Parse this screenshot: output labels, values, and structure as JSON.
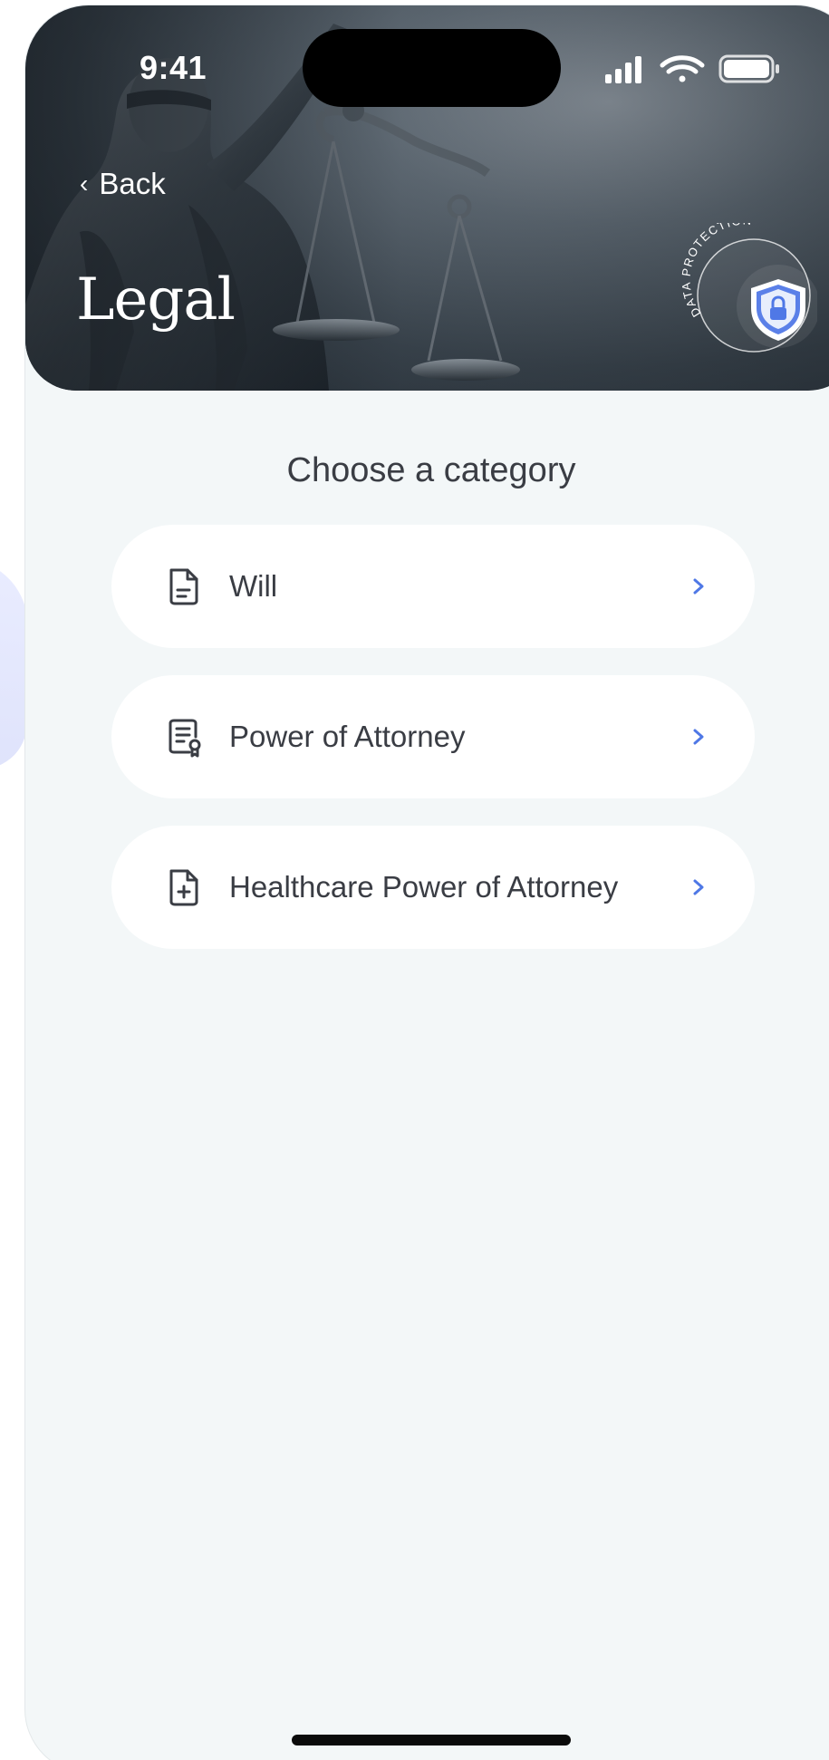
{
  "status_bar": {
    "time": "9:41",
    "icons": [
      "signal-icon",
      "wifi-icon",
      "battery-icon"
    ]
  },
  "header": {
    "back_label": "Back",
    "title": "Legal",
    "badge_text": "DATA PROTECTION",
    "badge_icon": "shield-lock-icon"
  },
  "main": {
    "heading": "Choose a category",
    "categories": [
      {
        "label": "Will",
        "icon": "document-icon"
      },
      {
        "label": "Power of Attorney",
        "icon": "certificate-icon"
      },
      {
        "label": "Healthcare Power of Attorney",
        "icon": "medical-document-icon"
      }
    ]
  },
  "colors": {
    "background": "#f3f7f8",
    "card": "#ffffff",
    "text": "#3a3d44",
    "accent": "#4f78e6"
  }
}
